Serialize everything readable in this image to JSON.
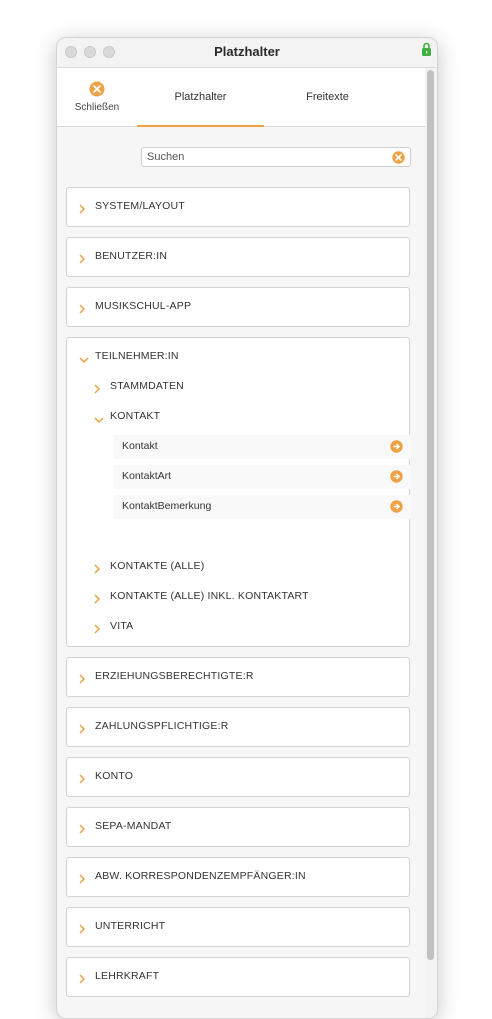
{
  "window": {
    "title": "Platzhalter"
  },
  "toolbar": {
    "close_label": "Schließen",
    "tabs": [
      {
        "label": "Platzhalter",
        "active": true
      },
      {
        "label": "Freitexte",
        "active": false
      }
    ]
  },
  "search": {
    "placeholder": "Suchen"
  },
  "categories": [
    {
      "label": "SYSTEM/LAYOUT",
      "expanded": false
    },
    {
      "label": "BENUTZER:IN",
      "expanded": false
    },
    {
      "label": "MUSIKSCHUL-APP",
      "expanded": false
    },
    {
      "label": "TEILNEHMER:IN",
      "expanded": true,
      "children": [
        {
          "label": "STAMMDATEN",
          "expanded": false
        },
        {
          "label": "KONTAKT",
          "expanded": true,
          "fields": [
            "Kontakt",
            "KontaktArt",
            "KontaktBemerkung"
          ]
        },
        {
          "label": "KONTAKTE (ALLE)",
          "expanded": false
        },
        {
          "label": "KONTAKTE (ALLE) INKL. KONTAKTART",
          "expanded": false
        },
        {
          "label": "VITA",
          "expanded": false
        }
      ]
    },
    {
      "label": "ERZIEHUNGSBERECHTIGTE:R",
      "expanded": false
    },
    {
      "label": "ZAHLUNGSPFLICHTIGE:R",
      "expanded": false
    },
    {
      "label": "KONTO",
      "expanded": false
    },
    {
      "label": "SEPA-MANDAT",
      "expanded": false
    },
    {
      "label": "ABW. KORRESPONDENZEMPFÄNGER:IN",
      "expanded": false
    },
    {
      "label": "UNTERRICHT",
      "expanded": false
    },
    {
      "label": "LEHRKRAFT",
      "expanded": false
    }
  ],
  "colors": {
    "accent": "#efa145",
    "card_border": "#d3d3d3",
    "background": "#f6f6f6"
  }
}
